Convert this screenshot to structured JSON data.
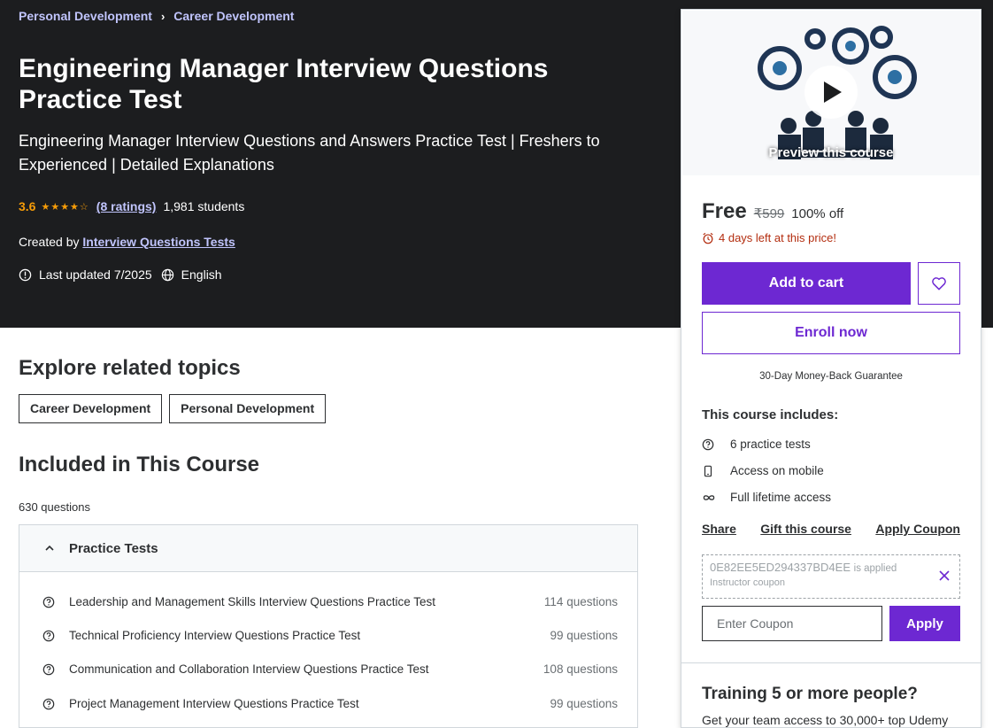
{
  "breadcrumb": [
    "Personal Development",
    "Career Development"
  ],
  "course": {
    "title": "Engineering Manager Interview Questions Practice Test",
    "subtitle": "Engineering Manager Interview Questions and Answers Practice Test | Freshers to Experienced | Detailed Explanations",
    "rating": "3.6",
    "rating_value": 3.6,
    "ratings_count": "(8 ratings)",
    "students": "1,981 students",
    "created_by_label": "Created by",
    "instructor": "Interview Questions Tests",
    "last_updated": "Last updated 7/2025",
    "language": "English"
  },
  "related": {
    "title": "Explore related topics",
    "topics": [
      "Career Development",
      "Personal Development"
    ]
  },
  "included": {
    "title": "Included in This Course",
    "question_count": "630 questions",
    "section_title": "Practice Tests",
    "items": [
      {
        "name": "Leadership and Management Skills Interview Questions Practice Test",
        "questions": "114 questions"
      },
      {
        "name": "Technical Proficiency Interview Questions Practice Test",
        "questions": "99 questions"
      },
      {
        "name": "Communication and Collaboration Interview Questions Practice Test",
        "questions": "108 questions"
      },
      {
        "name": "Project Management Interview Questions Practice Test",
        "questions": "99 questions"
      }
    ]
  },
  "sidebar": {
    "preview_label": "Preview this course",
    "price": "Free",
    "old_price": "₹599",
    "discount": "100% off",
    "timer": "4 days left at this price!",
    "add_to_cart": "Add to cart",
    "enroll": "Enroll now",
    "guarantee": "30-Day Money-Back Guarantee",
    "includes_title": "This course includes:",
    "includes": [
      {
        "icon": "question-circle-icon",
        "text": "6 practice tests"
      },
      {
        "icon": "mobile-icon",
        "text": "Access on mobile"
      },
      {
        "icon": "infinity-icon",
        "text": "Full lifetime access"
      }
    ],
    "links": [
      "Share",
      "Gift this course",
      "Apply Coupon"
    ],
    "coupon_code": "0E82EE5ED294337BD4EE",
    "coupon_applied": "is applied",
    "coupon_type": "Instructor coupon",
    "coupon_placeholder": "Enter Coupon",
    "apply": "Apply",
    "training_title": "Training 5 or more people?",
    "training_text": "Get your team access to 30,000+ top Udemy"
  },
  "colors": {
    "hero_bg": "#1c1d1f",
    "accent": "#6d28d2",
    "link_light": "#c0c4fc",
    "star": "#f69c08",
    "timer": "#b32d0f"
  }
}
